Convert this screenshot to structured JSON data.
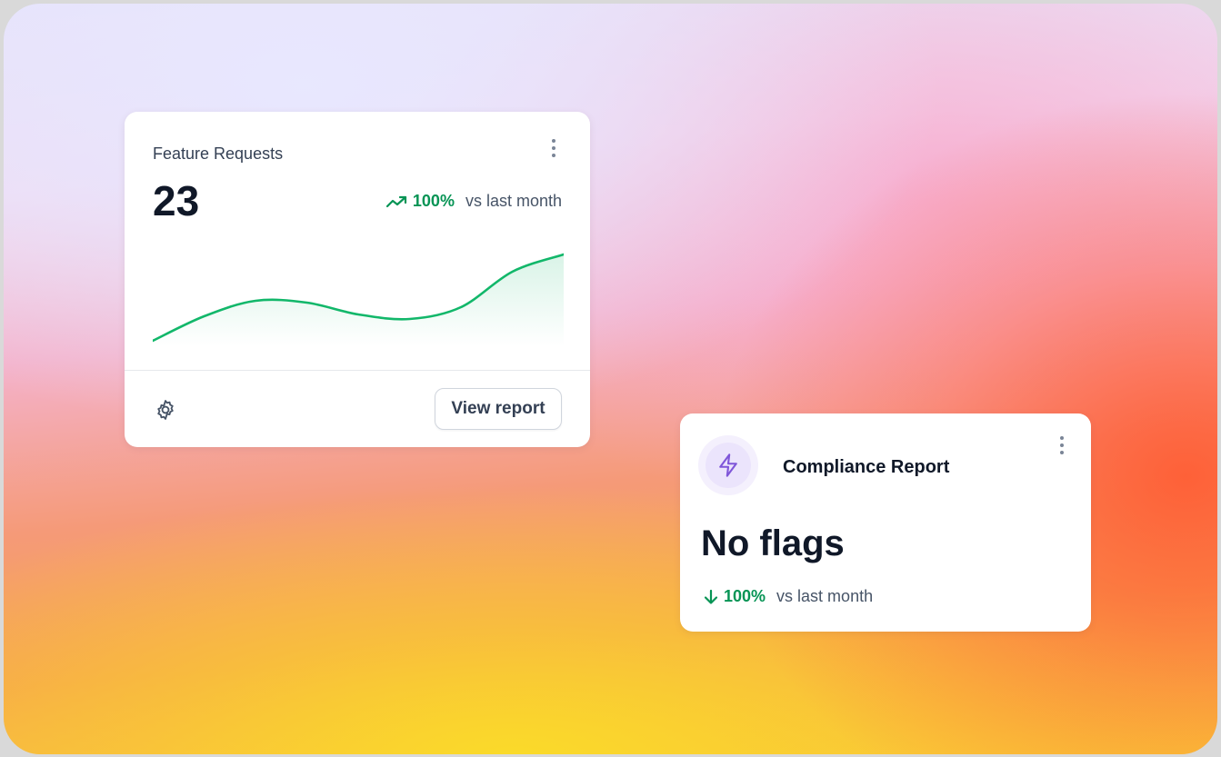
{
  "feature_card": {
    "title": "Feature Requests",
    "value": "23",
    "change_pct": "100%",
    "change_label": "vs last month",
    "trend_direction": "up",
    "action_label": "View report",
    "icons": {
      "menu": "more-vertical-icon",
      "trend": "trend-up-icon",
      "settings": "gear-icon"
    }
  },
  "compliance_card": {
    "title": "Compliance Report",
    "status": "No flags",
    "change_pct": "100%",
    "change_label": "vs last month",
    "trend_direction": "down",
    "icons": {
      "badge": "lightning-icon",
      "menu": "more-vertical-icon",
      "trend": "arrow-down-icon"
    }
  },
  "chart_data": {
    "type": "area",
    "title": "",
    "xlabel": "",
    "ylabel": "",
    "x": [
      0,
      1,
      2,
      3,
      4,
      5,
      6,
      7,
      8
    ],
    "values": [
      0,
      2.7,
      4.4,
      4.2,
      2.9,
      2.4,
      3.7,
      7.6,
      9.5
    ],
    "ylim": [
      0,
      10
    ],
    "grid": false,
    "legend": false
  },
  "colors": {
    "positive": "#079455",
    "chart_line": "#12b76a",
    "accent_purple": "#7f56d9",
    "text_primary": "#101828"
  }
}
